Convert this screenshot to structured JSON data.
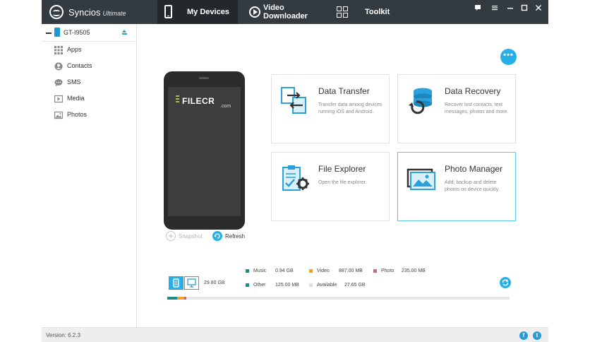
{
  "app": {
    "brand": "Syncios",
    "edition": "Ultimate",
    "version": "Version: 6.2.3"
  },
  "nav": {
    "tabs": [
      {
        "label": "My Devices",
        "active": true
      },
      {
        "label": "Video Downloader",
        "active": false
      },
      {
        "label": "Toolkit",
        "active": false
      }
    ]
  },
  "sidebar": {
    "device": "GT-I9505",
    "items": [
      {
        "label": "Apps",
        "icon": "apps-grid-icon"
      },
      {
        "label": "Contacts",
        "icon": "contacts-icon"
      },
      {
        "label": "SMS",
        "icon": "sms-icon"
      },
      {
        "label": "Media",
        "icon": "media-icon"
      },
      {
        "label": "Photos",
        "icon": "photos-icon"
      }
    ]
  },
  "device_panel": {
    "watermark": "FILECR",
    "watermark_sub": ".com",
    "snapshot_label": "Snapshot",
    "refresh_label": "Refresh"
  },
  "cards": [
    {
      "title": "Data Transfer",
      "desc": "Transfer data among devices running iOS and Android.",
      "icon": "data-transfer-icon"
    },
    {
      "title": "Data Recovery",
      "desc": "Recover lost contacts, text messages, photos and more.",
      "icon": "data-recovery-icon"
    },
    {
      "title": "File Explorer",
      "desc": "Open the file explorer",
      "icon": "file-explorer-icon"
    },
    {
      "title": "Photo Manager",
      "desc": "Add, backup and delete photos on device quickly.",
      "icon": "photo-manager-icon",
      "selected": true
    }
  ],
  "storage": {
    "total": "29.80 GB",
    "legend": [
      {
        "name": "Music",
        "value": "0.94 GB",
        "color": "#1f8a8a"
      },
      {
        "name": "Video",
        "value": "887.00 MB",
        "color": "#f0a030"
      },
      {
        "name": "Photo",
        "value": "235.00 MB",
        "color": "#e85a7a"
      },
      {
        "name": "Other",
        "value": "125.00 MB",
        "color": "#1f8a8a"
      },
      {
        "name": "Available",
        "value": "27.65 GB",
        "color": "#e0e0e0"
      }
    ]
  },
  "colors": {
    "accent": "#27b0e8",
    "titlebar": "#333a40"
  }
}
